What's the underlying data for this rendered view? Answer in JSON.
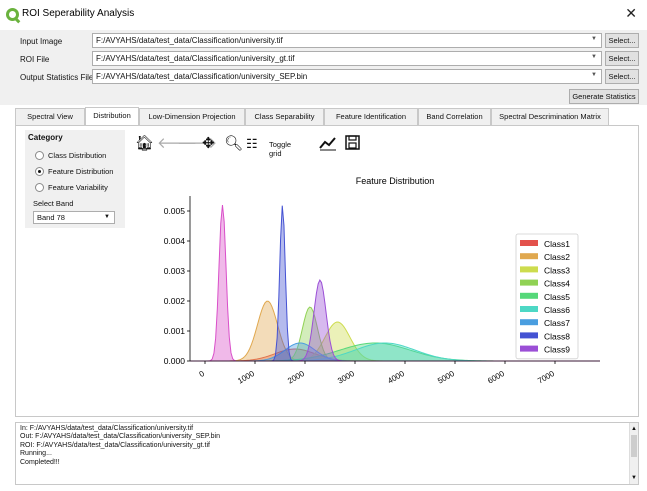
{
  "window": {
    "title": "ROI Seperability Analysis",
    "close_icon": "close-icon"
  },
  "inputs": {
    "input_image_label": "Input Image",
    "input_image_value": "F:/AVYAHS/data/test_data/Classification/university.tif",
    "roi_label": "ROI File",
    "roi_value": "F:/AVYAHS/data/test_data/Classification/university_gt.tif",
    "output_label": "Output Statistics File",
    "output_value": "F:/AVYAHS/data/test_data/Classification/university_SEP.bin",
    "select_label": "Select...",
    "generate_label": "Generate Statistics"
  },
  "tabs": [
    {
      "label": "Spectral View"
    },
    {
      "label": "Distribution"
    },
    {
      "label": "Low-Dimension Projection"
    },
    {
      "label": "Class Separability"
    },
    {
      "label": "Feature Identification"
    },
    {
      "label": "Band Correlation"
    },
    {
      "label": "Spectral Descrimination Matrix"
    }
  ],
  "active_tab": "Distribution",
  "category": {
    "title": "Category",
    "options": [
      {
        "label": "Class Distribution",
        "selected": false
      },
      {
        "label": "Feature Distribution",
        "selected": true
      },
      {
        "label": "Feature Variability",
        "selected": false
      }
    ],
    "select_band_label": "Select Band",
    "band_value": "Band 78"
  },
  "toolbar": {
    "icons": [
      "home-icon",
      "back-icon",
      "forward-icon",
      "pan-icon",
      "zoom-icon",
      "configure-icon",
      "line-edit-icon",
      "save-icon"
    ],
    "toggle_grid_label": "Toggle grid"
  },
  "chart_data": {
    "type": "area",
    "title": "Feature Distribution",
    "xlabel": "",
    "ylabel": "",
    "xlim": [
      -300,
      7900
    ],
    "ylim": [
      0,
      0.0055
    ],
    "x_ticks": [
      0,
      1000,
      2000,
      3000,
      4000,
      5000,
      6000,
      7000
    ],
    "x_tick_labels": [
      "0",
      "1000",
      "2000",
      "3000",
      "4000",
      "5000",
      "6000",
      "7000"
    ],
    "y_ticks": [
      0,
      0.001,
      0.002,
      0.003,
      0.004,
      0.005
    ],
    "y_tick_labels": [
      "0.000",
      "0.001",
      "0.002",
      "0.003",
      "0.004",
      "0.005"
    ],
    "grid": false,
    "legend_position": "right",
    "series": [
      {
        "name": "Class1",
        "color": "#e3524c",
        "mean": 1800,
        "std": 400,
        "peak": 0.0004
      },
      {
        "name": "Class2",
        "color": "#e0a84f",
        "mean": 1250,
        "std": 200,
        "peak": 0.002
      },
      {
        "name": "Class3",
        "color": "#cddc4e",
        "mean": 2650,
        "std": 250,
        "peak": 0.0013
      },
      {
        "name": "Class4",
        "color": "#90d254",
        "mean": 2100,
        "std": 150,
        "peak": 0.0018
      },
      {
        "name": "Class5",
        "color": "#56d87a",
        "mean": 3400,
        "std": 700,
        "peak": 0.0006
      },
      {
        "name": "Class6",
        "color": "#4dd8c5",
        "mean": 3600,
        "std": 600,
        "peak": 0.0006
      },
      {
        "name": "Class7",
        "color": "#4a9ee0",
        "mean": 1900,
        "std": 300,
        "peak": 0.0006
      },
      {
        "name": "Class8",
        "color": "#4452d3",
        "mean": 1550,
        "std": 55,
        "peak": 0.0052
      },
      {
        "name": "Class9",
        "color": "#9b4fd6",
        "mean": 2300,
        "std": 120,
        "peak": 0.0027
      },
      {
        "name": "",
        "color": "#d94fc9",
        "mean": 350,
        "std": 70,
        "peak": 0.0052
      }
    ]
  },
  "console": {
    "lines": [
      "In: F:/AVYAHS/data/test_data/Classification/university.tif",
      "Out: F:/AVYAHS/data/test_data/Classification/university_SEP.bin",
      "ROI: F:/AVYAHS/data/test_data/Classification/university_gt.tif",
      "Running...",
      "Completed!!!"
    ]
  }
}
